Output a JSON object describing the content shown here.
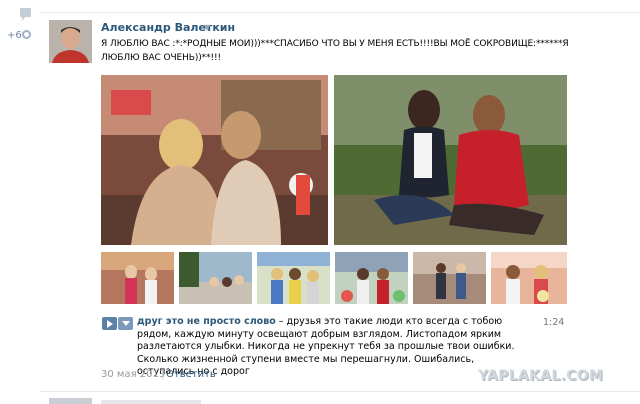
{
  "post": {
    "rating": "+6",
    "author": "Александр Валеткин",
    "text": "Я ЛЮБЛЮ ВАС :*:*РОДНЫЕ МОИ)))***СПАСИБО ЧТО ВЫ У МЕНЯ ЕСТЬ!!!!ВЫ МОЁ СОКРОВИЩЕ:******Я ЛЮБЛЮ ВАС ОЧЕНЬ))**!!!",
    "date": "30 мая 2013",
    "separator": "|",
    "reply": "Ответить"
  },
  "audio": {
    "title": "друг это не просто слово",
    "dash": " – ",
    "lyrics": "друзья это такие люди кто всегда с тобою рядом, каждую минуту освещают добрым взглядом. Листопадом ярким разлетаются улыбки. Никогда не упрекнут тебя за прошлые твои ошибки. Сколько жизненной ступени вместе мы перешагнули. Ошибались, оступались но с дорог",
    "duration": "1:24"
  },
  "watermark": "YAPLAKAL.COM",
  "colors": {
    "link": "#2b587a",
    "button": "#5d80a5",
    "meta": "#999999"
  },
  "icons": [
    "comment-icon",
    "gear-icon",
    "play-icon",
    "add-icon",
    "chevron-down-icon"
  ]
}
